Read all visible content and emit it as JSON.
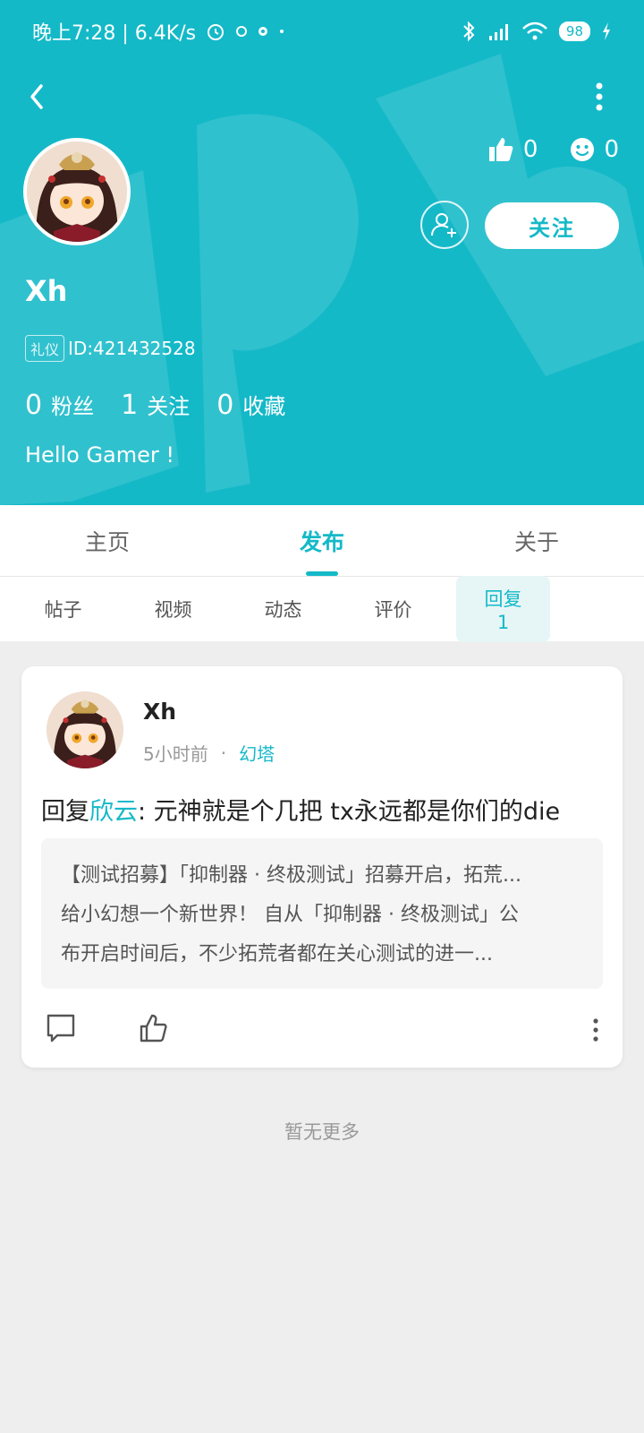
{
  "status_bar": {
    "time_speed": "晚上7:28 | 6.4K/s",
    "battery": "98"
  },
  "profile": {
    "likes_count": "0",
    "smile_count": "0",
    "follow_label": "关注",
    "username": "Xh",
    "badge": "礼仪",
    "id_text": "ID:421432528",
    "fans_count": "0",
    "fans_label": "粉丝",
    "following_count": "1",
    "following_label": "关注",
    "collect_count": "0",
    "collect_label": "收藏",
    "bio": "Hello Gamer !"
  },
  "tabs": [
    {
      "label": "主页"
    },
    {
      "label": "发布"
    },
    {
      "label": "关于"
    }
  ],
  "subtabs": [
    {
      "label": "帖子"
    },
    {
      "label": "视频"
    },
    {
      "label": "动态"
    },
    {
      "label": "评价"
    },
    {
      "label": "回复 1"
    }
  ],
  "post": {
    "author": "Xh",
    "time": "5小时前",
    "tag": "幻塔",
    "reply_prefix": "回复",
    "reply_mention": "欣云",
    "reply_text": ": 元神就是个几把 tx永远都是你们的die",
    "quote_lines": [
      "【测试招募】「抑制器 · 终极测试」招募开启，拓荒...",
      "给小幻想一个新世界！ 自从「抑制器 · 终极测试」公",
      "布开启时间后，不少拓荒者都在关心测试的进一..."
    ]
  },
  "footer": {
    "no_more": "暂无更多"
  },
  "colors": {
    "accent": "#14b9c8",
    "background": "#eeeeee"
  }
}
